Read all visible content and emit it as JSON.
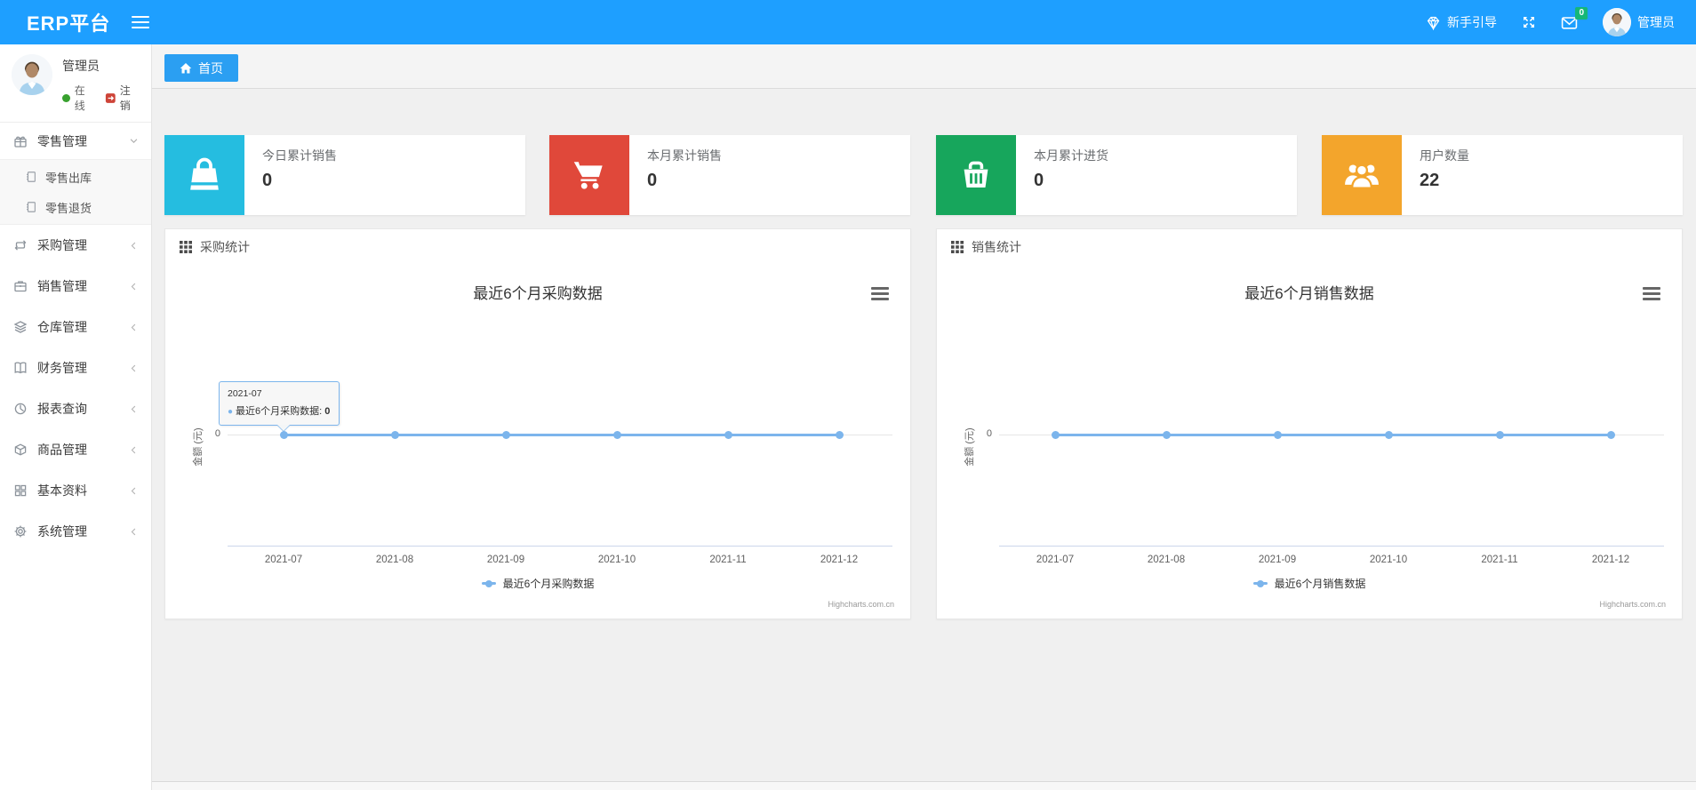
{
  "navbar": {
    "logo": "ERP平台",
    "guide_label": "新手引导",
    "mail_badge": "0",
    "username": "管理员",
    "accent_color": "#1E9FFF"
  },
  "sidebar": {
    "user": {
      "name": "管理员",
      "status": "在线",
      "logout": "注销"
    },
    "menu": [
      {
        "label": "零售管理",
        "icon": "gift-icon",
        "expanded": true,
        "children": [
          {
            "label": "零售出库"
          },
          {
            "label": "零售退货"
          }
        ]
      },
      {
        "label": "采购管理",
        "icon": "repeat-icon"
      },
      {
        "label": "销售管理",
        "icon": "briefcase-icon"
      },
      {
        "label": "仓库管理",
        "icon": "layers-icon"
      },
      {
        "label": "财务管理",
        "icon": "book-icon"
      },
      {
        "label": "报表查询",
        "icon": "pie-clock-icon"
      },
      {
        "label": "商品管理",
        "icon": "box-icon"
      },
      {
        "label": "基本资料",
        "icon": "grid-icon"
      },
      {
        "label": "系统管理",
        "icon": "gear-icon"
      }
    ]
  },
  "tabs": [
    {
      "label": "首页",
      "active": true
    }
  ],
  "cards": [
    {
      "label": "今日累计销售",
      "value": "0",
      "color": "#25bde0",
      "icon": "bag-icon"
    },
    {
      "label": "本月累计销售",
      "value": "0",
      "color": "#e0483a",
      "icon": "cart-icon"
    },
    {
      "label": "本月累计进货",
      "value": "0",
      "color": "#17a65c",
      "icon": "basket-icon"
    },
    {
      "label": "用户数量",
      "value": "22",
      "color": "#f3a52c",
      "icon": "users-icon"
    }
  ],
  "panels": [
    {
      "header": "采购统计"
    },
    {
      "header": "销售统计"
    }
  ],
  "chart_data": [
    {
      "type": "line",
      "title": "最近6个月采购数据",
      "ylabel": "金额 (元)",
      "categories": [
        "2021-07",
        "2021-08",
        "2021-09",
        "2021-10",
        "2021-11",
        "2021-12"
      ],
      "series": [
        {
          "name": "最近6个月采购数据",
          "values": [
            0,
            0,
            0,
            0,
            0,
            0
          ]
        }
      ],
      "y_tick_labels": [
        "0"
      ],
      "ylim_visible_tick": 0,
      "line_color": "#7cb5ec",
      "legend_position": "bottom",
      "grid": "horizontal-zero-line",
      "credits": "Highcharts.com.cn",
      "tooltip": {
        "x": "2021-07",
        "series": "最近6个月采购数据",
        "value": "0"
      }
    },
    {
      "type": "line",
      "title": "最近6个月销售数据",
      "ylabel": "金额 (元)",
      "categories": [
        "2021-07",
        "2021-08",
        "2021-09",
        "2021-10",
        "2021-11",
        "2021-12"
      ],
      "series": [
        {
          "name": "最近6个月销售数据",
          "values": [
            0,
            0,
            0,
            0,
            0,
            0
          ]
        }
      ],
      "y_tick_labels": [
        "0"
      ],
      "ylim_visible_tick": 0,
      "line_color": "#7cb5ec",
      "legend_position": "bottom",
      "grid": "horizontal-zero-line",
      "credits": "Highcharts.com.cn"
    }
  ]
}
